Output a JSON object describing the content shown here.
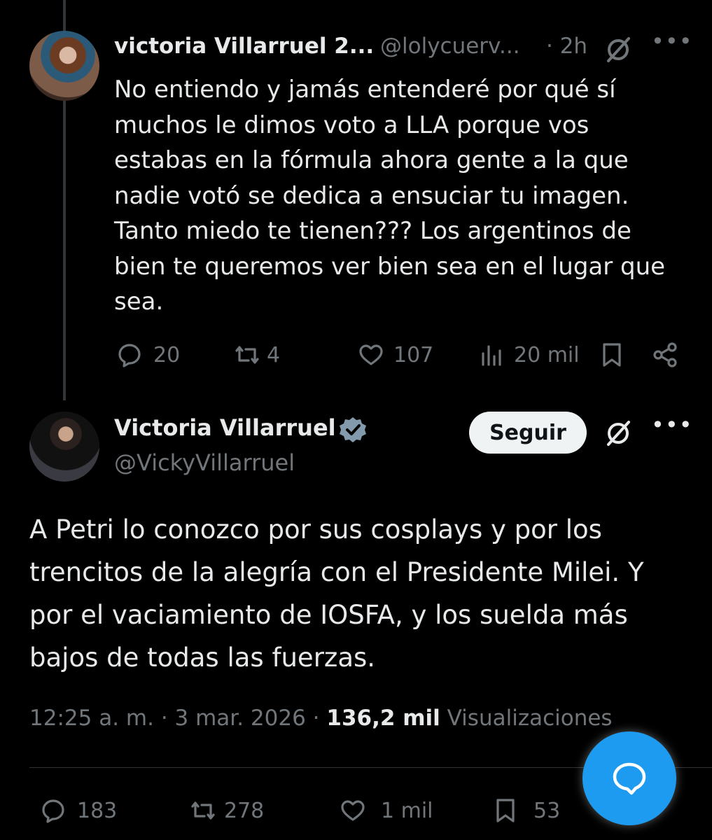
{
  "reply_tweet": {
    "display_name": "victoria Villarruel 2...",
    "handle": "@lolycuerv...",
    "time": "· 2h",
    "more": "•••",
    "text": "No entiendo y jamás entenderé por qué sí muchos le dimos voto a LLA porque vos estabas en la fórmula ahora gente a la que nadie votó se dedica a ensuciar tu imagen. Tanto miedo te tienen??? Los argentinos de bien te queremos ver bien sea en el lugar que sea.",
    "replies": "20",
    "reposts": "4",
    "likes": "107",
    "views": "20 mil"
  },
  "main_tweet": {
    "display_name": "Victoria Villarruel",
    "handle": "@VickyVillarruel",
    "follow_label": "Seguir",
    "more": "•••",
    "text": "A Petri lo conozco por sus cosplays y por los trencitos de la alegría con el Presidente Milei. Y por el vaciamiento de IOSFA, y los suelda más bajos de todas las fuerzas.",
    "time": "12:25 a. m.",
    "separator": "·",
    "date": "3 mar. 2026",
    "views_count": "136,2 mil",
    "views_label": "Visualizaciones",
    "replies": "183",
    "reposts": "278",
    "likes": "1 mil",
    "bookmarks": "53"
  },
  "colors": {
    "accent": "#1d9bf0",
    "muted": "#71767b",
    "text": "#e7e9ea",
    "background": "#000000"
  }
}
